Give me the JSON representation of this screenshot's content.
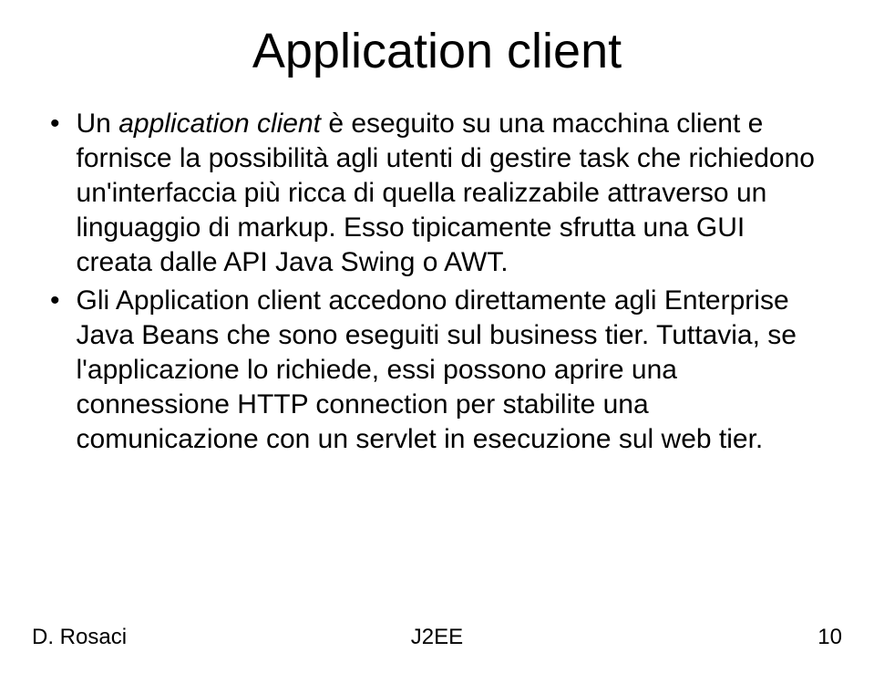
{
  "title": "Application client",
  "bullets": [
    {
      "segments": [
        {
          "text": "Un ",
          "italic": false
        },
        {
          "text": "application client",
          "italic": true
        },
        {
          "text": " è eseguito su una macchina client e fornisce la possibilità agli utenti di gestire task che richiedono un'interfaccia più ricca di quella realizzabile attraverso un linguaggio di markup. Esso tipicamente sfrutta una GUI creata dalle API Java Swing o AWT.",
          "italic": false
        }
      ]
    },
    {
      "segments": [
        {
          "text": "Gli Application client accedono direttamente agli Enterprise Java Beans che sono eseguiti sul business tier. Tuttavia, se l'applicazione lo richiede, essi possono aprire una connessione HTTP connection per stabilite una comunicazione con un servlet in esecuzione sul web tier.",
          "italic": false
        }
      ]
    }
  ],
  "footer": {
    "left": "D. Rosaci",
    "center": "J2EE",
    "right": "10"
  }
}
